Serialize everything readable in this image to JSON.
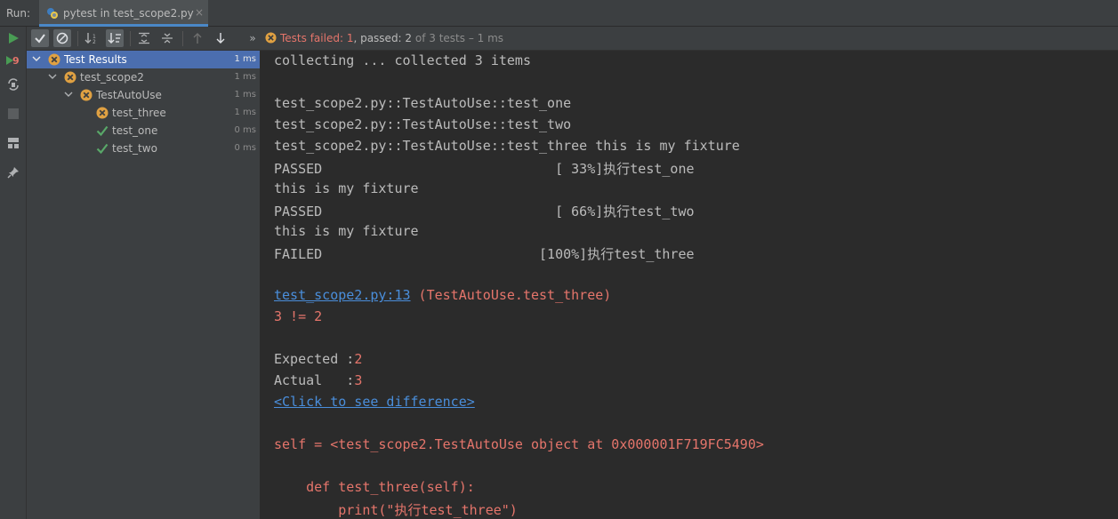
{
  "run_bar": {
    "label": "Run:",
    "tab_title": "pytest in test_scope2.py",
    "close_glyph": "×"
  },
  "status": {
    "failed_label": "Tests failed: ",
    "failed_count": "1",
    "passed_label": ", passed: ",
    "passed_count": "2",
    "of_label": " of 3 tests – 1 ms"
  },
  "tree": {
    "items": [
      {
        "label": "Test Results",
        "time": "1 ms",
        "status": "failed",
        "level": 0
      },
      {
        "label": "test_scope2",
        "time": "1 ms",
        "status": "failed",
        "level": 1
      },
      {
        "label": "TestAutoUse",
        "time": "1 ms",
        "status": "failed",
        "level": 2
      },
      {
        "label": "test_three",
        "time": "1 ms",
        "status": "failed",
        "level": 3
      },
      {
        "label": "test_one",
        "time": "0 ms",
        "status": "passed",
        "level": 3
      },
      {
        "label": "test_two",
        "time": "0 ms",
        "status": "passed",
        "level": 3
      }
    ]
  },
  "console": {
    "l1": "collecting ... collected 3 items",
    "l2": "test_scope2.py::TestAutoUse::test_one",
    "l3": "test_scope2.py::TestAutoUse::test_two",
    "l4": "test_scope2.py::TestAutoUse::test_three this is my fixture",
    "l5": "PASSED                             [ 33%]执行test_one",
    "l6": "this is my fixture",
    "l7": "PASSED                             [ 66%]执行test_two",
    "l8": "this is my fixture",
    "l9": "FAILED                           [100%]执行test_three",
    "l10_link": "test_scope2.py:13",
    "l10_rest": " (TestAutoUse.test_three)",
    "l11": "3 != 2",
    "l12_label": "Expected :",
    "l12_value": "2",
    "l13_label": "Actual   :",
    "l13_value": "3",
    "l14_link": "<Click to see difference>",
    "l15": "self = <test_scope2.TestAutoUse object at 0x000001F719FC5490>",
    "l16": "    def test_three(self):",
    "l17": "        print(\"执行test_three\")"
  },
  "colors": {
    "failed": "#e5756b",
    "passed": "#59a869",
    "link": "#4a8edb",
    "selection": "#4b6eaf"
  },
  "icons": {
    "toolbar": [
      "rerun-icon",
      "rerun-failed-icon",
      "toggle-auto-test-icon",
      "stop-icon",
      "layout-icon",
      "pin-icon",
      "show-passed-icon",
      "show-ignored-icon",
      "sort-alpha-icon",
      "sort-duration-icon",
      "expand-all-icon",
      "collapse-all-icon",
      "previous-failed-icon",
      "next-failed-icon",
      "more-icon"
    ]
  }
}
